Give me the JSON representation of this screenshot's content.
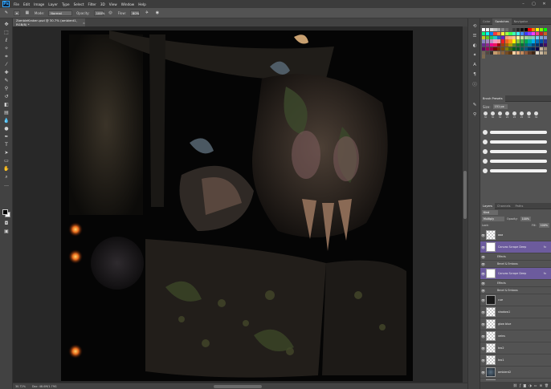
{
  "menu": [
    "File",
    "Edit",
    "Image",
    "Layer",
    "Type",
    "Select",
    "Filter",
    "3D",
    "View",
    "Window",
    "Help"
  ],
  "options": {
    "mode_label": "Mode:",
    "mode_value": "Normal",
    "opacity_label": "Opacity:",
    "opacity_value": "100%",
    "flow_label": "Flow:",
    "flow_value": "80%"
  },
  "document": {
    "tab_title": "ZombieKraken.psd @ 30.7% (ambient1, RGB/8) *",
    "zoom": "30.72%",
    "doc_size": "Doc: 48.0M/1.79G"
  },
  "color_panel": {
    "tabs": [
      "Color",
      "Swatches",
      "Navigator"
    ],
    "active": "Swatches"
  },
  "swatch_colors": [
    "#ffffff",
    "#eeeeee",
    "#d9d9d9",
    "#c0c0c0",
    "#a6a6a6",
    "#8a8a8a",
    "#6e6e6e",
    "#555555",
    "#3d3d3d",
    "#262626",
    "#111111",
    "#000000",
    "#ff0000",
    "#ff7f00",
    "#ffff00",
    "#7fff00",
    "#00ff00",
    "#00ff7f",
    "#00ffff",
    "#007fff",
    "#ff3b3b",
    "#ff8c3b",
    "#fff23b",
    "#a8ff3b",
    "#3bff4f",
    "#3bffb8",
    "#3bf2ff",
    "#3b8cff",
    "#3b3bff",
    "#8c3bff",
    "#ff3bff",
    "#ff3b8c",
    "#c82020",
    "#c86420",
    "#c8c820",
    "#64c820",
    "#20c864",
    "#20c8c8",
    "#2064c8",
    "#6420c8",
    "#f7977a",
    "#f9ad81",
    "#fdc68a",
    "#fff79a",
    "#c4df9b",
    "#a2d39c",
    "#82ca9d",
    "#7bcdc8",
    "#6ecff6",
    "#7ea7d8",
    "#8493ca",
    "#8882be",
    "#a187be",
    "#bc8dbf",
    "#f49ac2",
    "#f6989d",
    "#ed1c24",
    "#f26522",
    "#f7941d",
    "#fff200",
    "#8dc63f",
    "#39b54a",
    "#00a651",
    "#00a99d",
    "#00aeef",
    "#0072bc",
    "#0054a6",
    "#2e3192",
    "#662d91",
    "#92278f",
    "#ec008c",
    "#ed145b",
    "#9e0b0f",
    "#a0410d",
    "#a36209",
    "#aba000",
    "#598527",
    "#197b30",
    "#007236",
    "#00746b",
    "#0076a3",
    "#004b80",
    "#003471",
    "#1b1464",
    "#440e62",
    "#630460",
    "#9e005d",
    "#9e0039",
    "#790000",
    "#7b2e00",
    "#7d4900",
    "#827b00",
    "#406618",
    "#005e20",
    "#005826",
    "#005952",
    "#005b7f",
    "#003663",
    "#002157",
    "#0d004c",
    "#c7b299",
    "#998675",
    "#736357",
    "#534741",
    "#37302d",
    "#c69c6d",
    "#a67c52",
    "#8c6239",
    "#754c24",
    "#603913",
    "#fbd2a4",
    "#e9b383",
    "#c48a5b",
    "#8f5b3b",
    "#5e3a26",
    "#3f2616",
    "#e4d7c5",
    "#cbb89d",
    "#a89578",
    "#7c6a4f"
  ],
  "brush_panel": {
    "title": "Brush Presets",
    "size_label": "Size:",
    "size_value": "151 px",
    "tip_numbers": [
      "30",
      "30",
      "30",
      "25",
      "25",
      "25",
      "36",
      "36"
    ]
  },
  "layers_panel": {
    "tabs": [
      "Layers",
      "Channels",
      "Paths"
    ],
    "filter_label": "Kind",
    "blend_mode": "Multiply",
    "opacity_label": "Opacity:",
    "opacity_value": "100%",
    "lock_label": "Lock:",
    "fill_label": "Fill:",
    "fill_value": "100%",
    "layers": [
      {
        "name": "aoa",
        "thumb": "check",
        "fx": ""
      },
      {
        "name": "Canvas Scrape Deep",
        "thumb": "white",
        "fx": "fx",
        "purple": true
      },
      {
        "sub": "Effects"
      },
      {
        "sub": "Bevel & Emboss"
      },
      {
        "name": "Canvas Scrape Deep",
        "thumb": "white",
        "fx": "fx",
        "purple": true
      },
      {
        "sub": "Effects"
      },
      {
        "sub": "Bevel & Emboss"
      },
      {
        "name": "cue",
        "thumb": "dark",
        "fx": ""
      },
      {
        "name": "shadow1",
        "thumb": "check",
        "fx": ""
      },
      {
        "name": "glow blue",
        "thumb": "check",
        "fx": ""
      },
      {
        "name": "veins",
        "thumb": "check",
        "fx": ""
      },
      {
        "name": "tex2",
        "thumb": "check",
        "fx": ""
      },
      {
        "name": "tex1",
        "thumb": "check",
        "fx": ""
      },
      {
        "name": "ambient2",
        "thumb": "tex",
        "fx": ""
      },
      {
        "name": "ambient1",
        "thumb": "tex",
        "fx": ""
      }
    ]
  }
}
